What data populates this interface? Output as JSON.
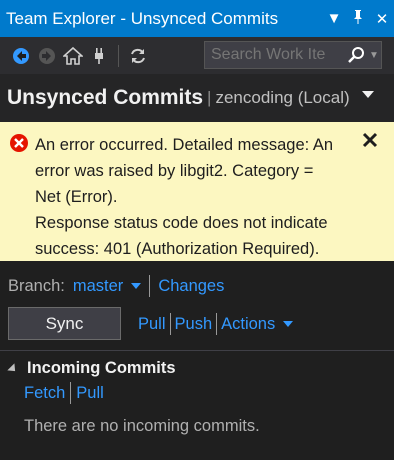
{
  "window": {
    "title": "Team Explorer - Unsynced Commits",
    "controls": [
      "▼",
      "⊥",
      "✕"
    ]
  },
  "toolbar": {
    "buttons": [
      "back-icon",
      "forward-icon",
      "home-icon",
      "connect-icon",
      "refresh-icon"
    ],
    "search_placeholder": "Search Work Ite"
  },
  "header": {
    "title": "Unsynced Commits",
    "context": "zencoding (Local)"
  },
  "error": {
    "lines": [
      "An error occurred. Detailed message: An",
      "error was raised by libgit2. Category =",
      "Net (Error).",
      "Response status code does not indicate",
      "success: 401 (Authorization Required)."
    ]
  },
  "branch": {
    "label": "Branch:",
    "value": "master",
    "changes_link": "Changes"
  },
  "actions": {
    "sync": "Sync",
    "pull": "Pull",
    "push": "Push",
    "actions": "Actions"
  },
  "incoming": {
    "title": "Incoming Commits",
    "fetch": "Fetch",
    "pull": "Pull",
    "empty_text": "There are no incoming commits."
  },
  "colors": {
    "accent": "#007acc",
    "link": "#3399ff",
    "error_bg": "#fcf7c1",
    "error_icon": "#e51400"
  }
}
